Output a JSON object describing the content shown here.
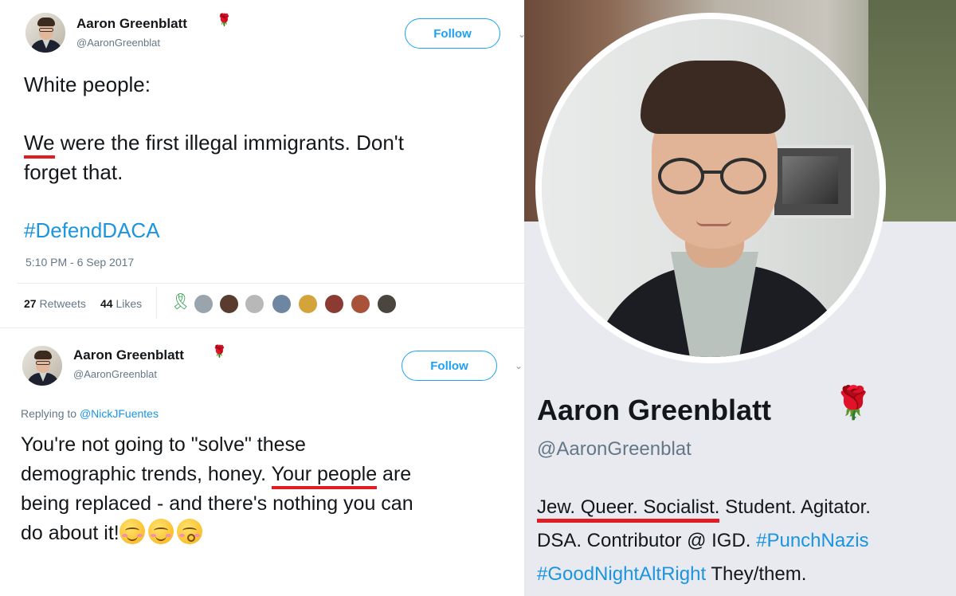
{
  "tweet1": {
    "display_name": "Aaron Greenblatt",
    "handle": "@AaronGreenblat",
    "follow_label": "Follow",
    "text_line1": "White people:",
    "text_we": "We",
    "text_line2_rest": " were the first illegal immigrants. Don't",
    "text_line3": "forget that.",
    "hashtag": "#DefendDACA",
    "timestamp": "5:10 PM - 6 Sep 2017",
    "retweets_count": "27",
    "retweets_label": "Retweets",
    "likes_count": "44",
    "likes_label": "Likes"
  },
  "tweet2": {
    "display_name": "Aaron Greenblatt",
    "handle": "@AaronGreenblat",
    "follow_label": "Follow",
    "replying_prefix": "Replying to",
    "replying_to": "@NickJFuentes",
    "line1": "You're not going to \"solve\" these",
    "line2_pre": "demographic trends, honey. ",
    "line2_underlined": "Your people",
    "line2_post": " are",
    "line3": "being replaced - and there's nothing you can",
    "line4": "do about it!"
  },
  "profile": {
    "name": "Aaron Greenblatt",
    "handle": "@AaronGreenblat",
    "bio_underlined": "Jew. Queer. Socialist.",
    "bio_part1": " Student. Agitator.",
    "bio_line2": "DSA. Contributor @ IGD. ",
    "bio_hashtag1": "#PunchNazis",
    "bio_hashtag2": "#GoodNightAltRight",
    "bio_tail": " They/them."
  },
  "colors": {
    "link_blue": "#1b95e0",
    "underline_red": "#e11d24",
    "rose_red": "#c0102a"
  }
}
